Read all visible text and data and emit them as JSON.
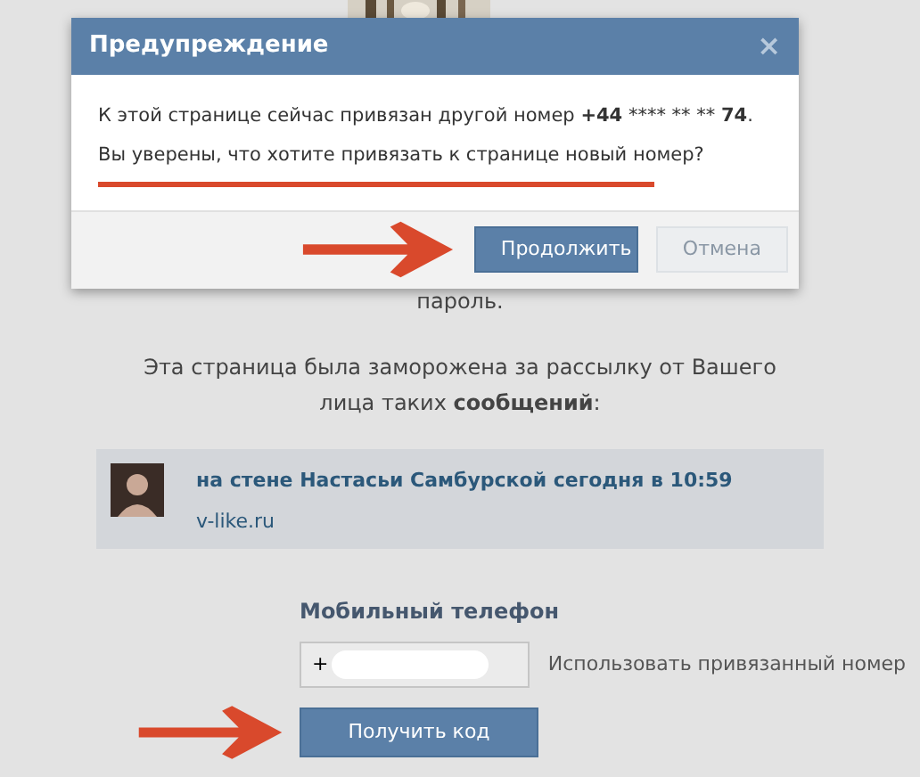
{
  "dialog": {
    "title": "Предупреждение",
    "close": "×",
    "message_lines": [
      [
        {
          "text": "К этой странице сейчас привязан другой номер ",
          "bold": false
        },
        {
          "text": "+44",
          "bold": true
        },
        {
          "text": " **** ** ** ",
          "bold": false
        },
        {
          "text": "74",
          "bold": true
        },
        {
          "text": ".",
          "bold": false
        }
      ],
      [
        {
          "text": "Вы уверены, что хотите привязать к странице новый номер?",
          "bold": false
        }
      ]
    ],
    "buttons": [
      {
        "label": "Продолжить",
        "kind": "primary"
      },
      {
        "label": "Отмена",
        "kind": "secondary"
      }
    ]
  },
  "page": {
    "text_tail": "пароль.",
    "frozen_notice": "Эта страница была заморожена за рассылку от Вашего лица таких **сообщений**:",
    "post": {
      "link": "на стене Настасьи Самбурской сегодня в 10:59",
      "site": "v-like.ru"
    },
    "phone": {
      "label": "Мобильный телефон",
      "value": "+",
      "use_linked": "Использовать привязанный номер",
      "submit": "Получить код"
    }
  }
}
